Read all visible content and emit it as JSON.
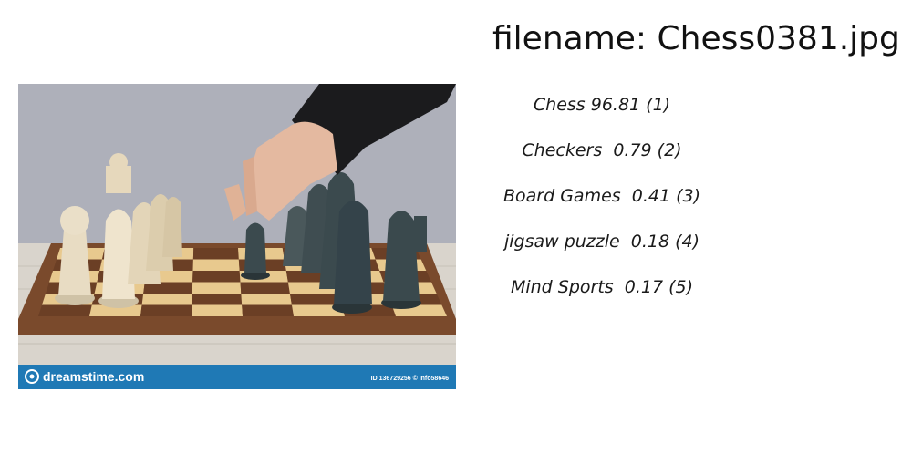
{
  "title": "filename: Chess0381.jpg",
  "photo": {
    "subject": "hand moving a dark chess piece on a chessboard",
    "watermark_brand": "dreamstime.com",
    "watermark_id": "ID 136729256 © Info58646",
    "colors": {
      "background": "#a9aab5",
      "table": "#d9d4cc",
      "board_dark": "#6b3f25",
      "board_light": "#e8c98e",
      "board_frame": "#7a4a2c",
      "banner": "#1f79b5",
      "ivory_piece": "#e8dcc3",
      "dark_piece": "#3b4a4e",
      "sleeve": "#1b1b1d",
      "hand": "#e4b9a0"
    }
  },
  "results": [
    {
      "label": "Chess",
      "score": "96.81",
      "rank": "(1)",
      "text": "Chess 96.81 (1)"
    },
    {
      "label": "Checkers",
      "score": "0.79",
      "rank": "(2)",
      "text": "Checkers  0.79 (2)"
    },
    {
      "label": "Board Games",
      "score": "0.41",
      "rank": "(3)",
      "text": "Board Games  0.41 (3)"
    },
    {
      "label": "jigsaw puzzle",
      "score": "0.18",
      "rank": "(4)",
      "text": "jigsaw puzzle  0.18 (4)"
    },
    {
      "label": "Mind Sports",
      "score": "0.17",
      "rank": "(5)",
      "text": "Mind Sports  0.17 (5)"
    }
  ]
}
